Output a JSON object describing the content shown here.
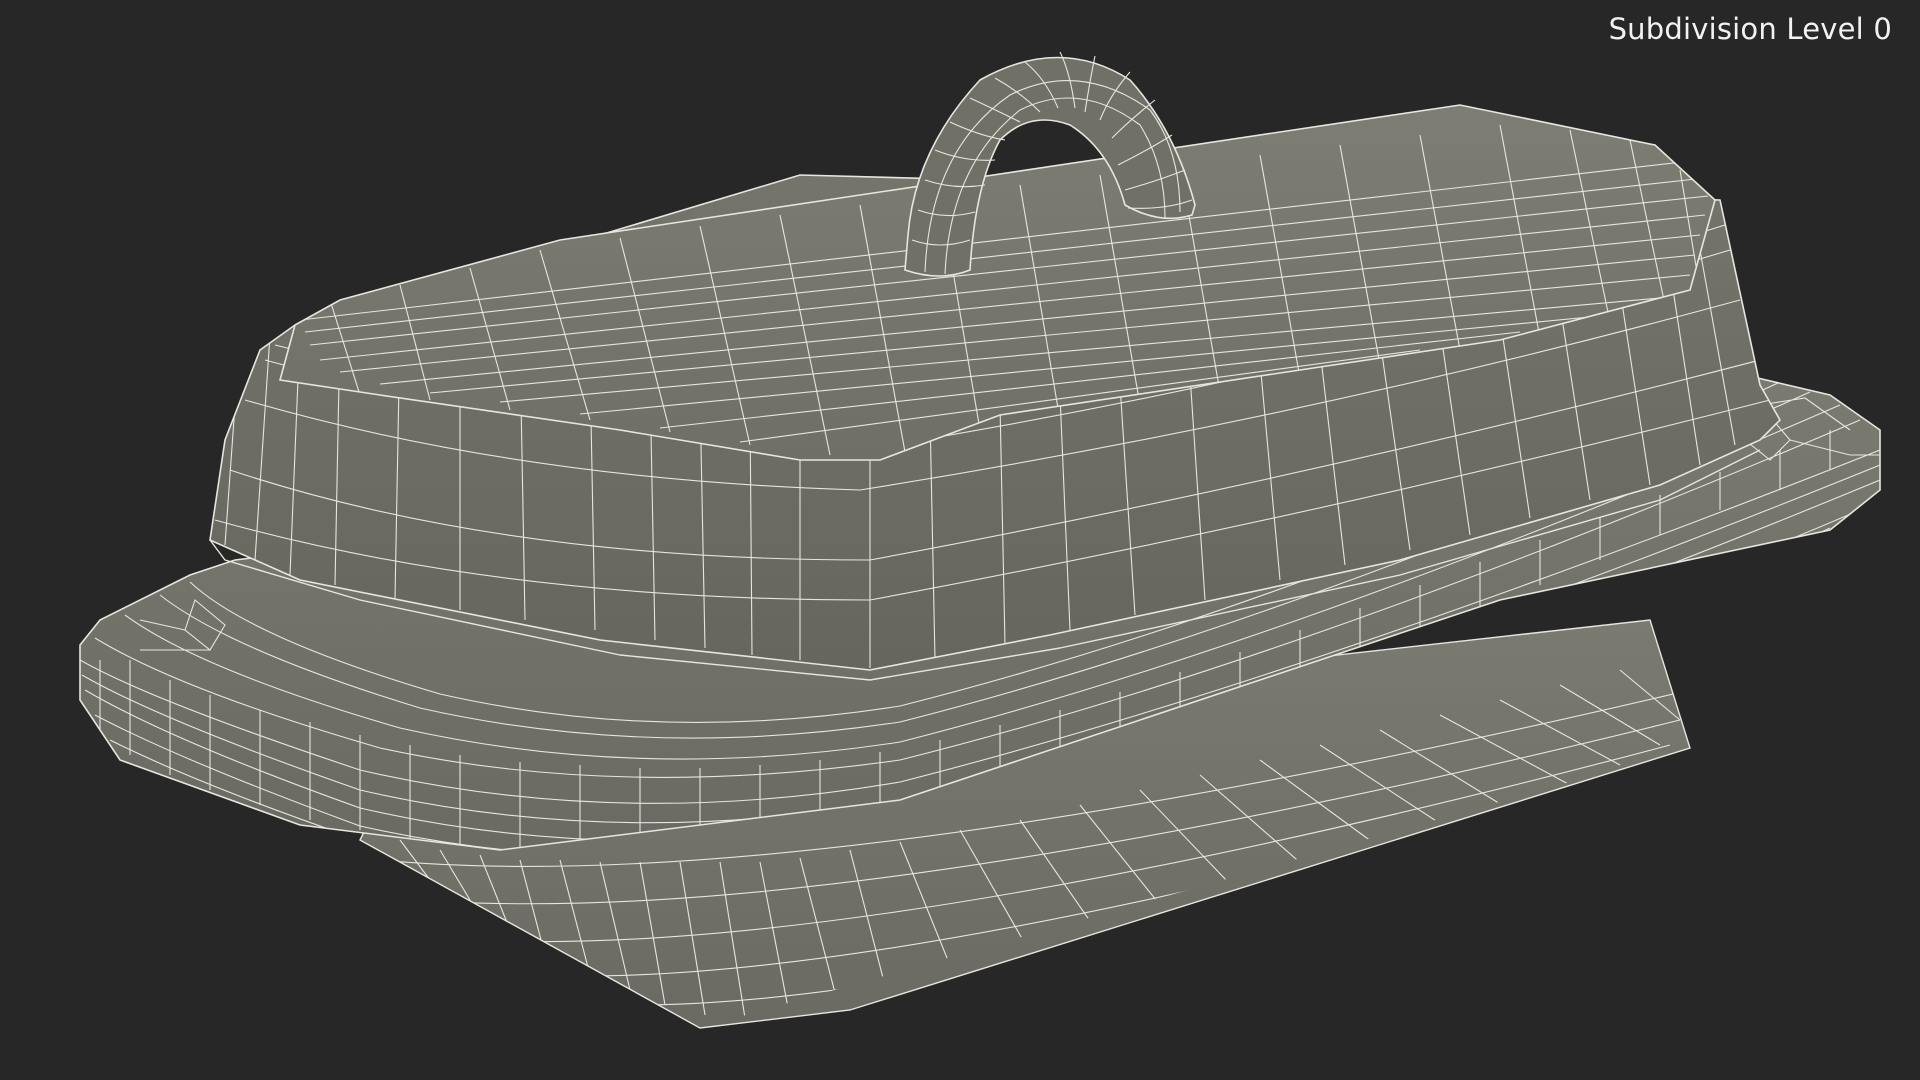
{
  "viewport": {
    "subdivision_label": "Subdivision Level 0",
    "background_color": "#272727",
    "model": {
      "subject": "butter-dish-with-lid",
      "surface_color": "#76766c",
      "wire_color": "#e6e6df"
    }
  }
}
